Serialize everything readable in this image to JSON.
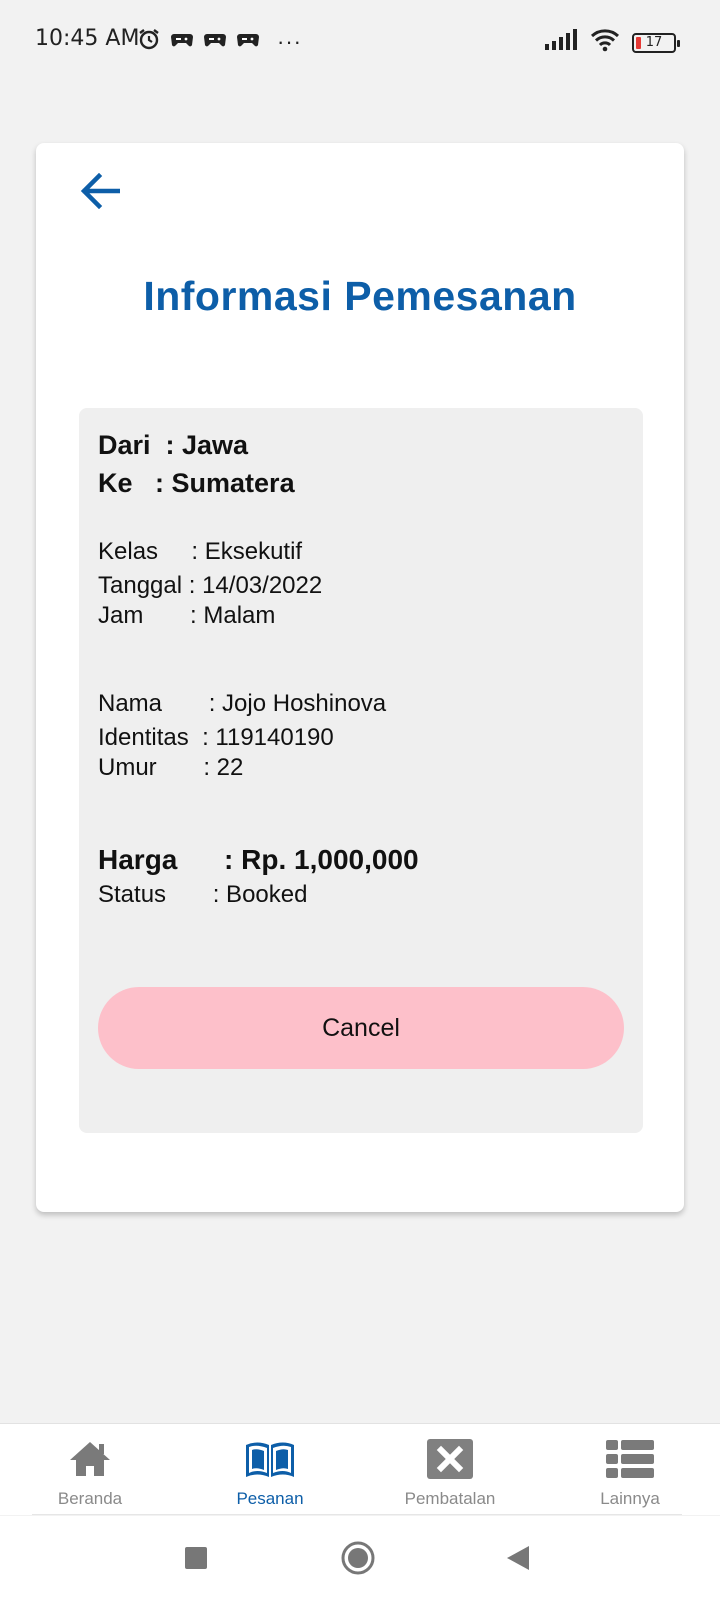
{
  "status_bar": {
    "time": "10:45 AM",
    "more_indicator": "···",
    "battery_level": "17",
    "icons": [
      "alarm-icon",
      "game-icon",
      "game-icon",
      "game-icon",
      "signal-icon",
      "wifi-icon",
      "battery-icon"
    ]
  },
  "page": {
    "title": "Informasi  Pemesanan",
    "back_icon": "arrow-left-icon"
  },
  "booking": {
    "from_label": "Dari  ",
    "from_value": ": Jawa",
    "to_label": "Ke   ",
    "to_value": ": Sumatera",
    "class_label": "Kelas     ",
    "class_value": ": Eksekutif",
    "date_label": "Tanggal ",
    "date_value": ": 14/03/2022",
    "time_label": "Jam       ",
    "time_value": ": Malam",
    "name_label": "Nama       ",
    "name_value": ": Jojo Hoshinova",
    "id_label": "Identitas  ",
    "id_value": ": 119140190",
    "age_label": "Umur       ",
    "age_value": ": 22",
    "price_label": "Harga      ",
    "price_value": ": Rp. 1,000,000",
    "status_label": "Status       ",
    "status_value": ": Booked"
  },
  "actions": {
    "cancel_label": "Cancel",
    "cancel_color": "#fdc0ca"
  },
  "bottom_nav": {
    "items": [
      {
        "label": "Beranda",
        "icon": "home-icon",
        "active": false
      },
      {
        "label": "Pesanan",
        "icon": "book-icon",
        "active": true
      },
      {
        "label": "Pembatalan",
        "icon": "cancel-box-icon",
        "active": false
      },
      {
        "label": "Lainnya",
        "icon": "list-icon",
        "active": false
      }
    ]
  },
  "system_nav": {
    "icons": [
      "square-recents-icon",
      "circle-home-icon",
      "triangle-back-icon"
    ]
  },
  "colors": {
    "primary": "#0d5ea8",
    "background": "#f2f2f2",
    "info_box": "#efefef",
    "inactive": "#8a8a8a"
  }
}
